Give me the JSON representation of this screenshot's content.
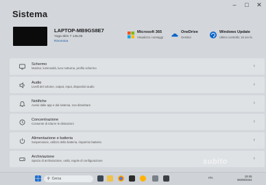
{
  "window": {
    "title": "Sistema"
  },
  "device": {
    "name": "LAPTOP-MB9GS8E7",
    "model": "Yoga Slim 7 14IL05",
    "rename_label": "Rinomina"
  },
  "quick_tiles": [
    {
      "icon": "microsoft-365-icon",
      "title": "Microsoft 365",
      "subtitle": "Visualizza i vantaggi"
    },
    {
      "icon": "onedrive-icon",
      "title": "OneDrive",
      "subtitle": "Gestisci"
    },
    {
      "icon": "windows-update-icon",
      "title": "Windows Update",
      "subtitle": "Ultimo controllo: 15 ore fa"
    }
  ],
  "settings": [
    {
      "icon": "monitor-icon",
      "title": "Schermo",
      "subtitle": "Monitor, luminosità, luce notturna, profilo schermo"
    },
    {
      "icon": "speaker-icon",
      "title": "Audio",
      "subtitle": "Livelli del volume, output, input, dispositivi audio"
    },
    {
      "icon": "bell-icon",
      "title": "Notifiche",
      "subtitle": "Avvisi dalle app e dal sistema, non disturbare"
    },
    {
      "icon": "focus-icon",
      "title": "Concentrazione",
      "subtitle": "Consente di ridurre le distrazioni"
    },
    {
      "icon": "power-icon",
      "title": "Alimentazione e batteria",
      "subtitle": "Sospensione, utilizzo della batteria, risparmio batteria"
    },
    {
      "icon": "storage-icon",
      "title": "Archiviazione",
      "subtitle": "Spazio di archiviazione, unità, regole di configurazione"
    }
  ],
  "taskbar": {
    "search_placeholder": "Cerca",
    "lang": "ITA",
    "time": "19:45",
    "date": "06/09/2024"
  },
  "watermark": "subito"
}
